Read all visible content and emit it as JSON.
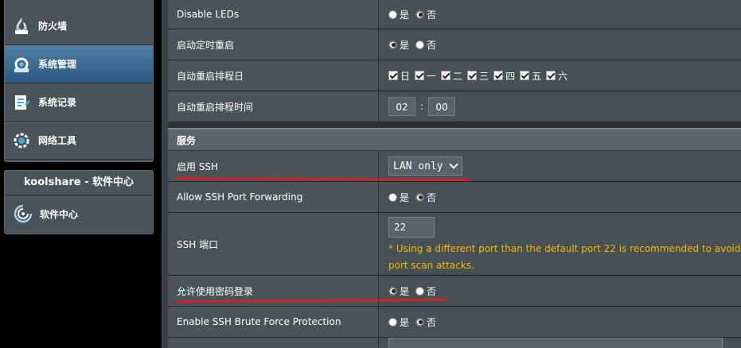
{
  "sidebar": {
    "items": [
      {
        "label": "防火墙",
        "icon": "firewall-icon"
      },
      {
        "label": "系统管理",
        "icon": "system-admin-icon",
        "active": true
      },
      {
        "label": "系统记录",
        "icon": "system-log-icon"
      },
      {
        "label": "网络工具",
        "icon": "network-tools-icon"
      }
    ],
    "koolshare": {
      "title": "koolshare - 软件中心",
      "item_label": "软件中心",
      "item_icon": "software-center-icon"
    }
  },
  "settings": {
    "disable_leds": {
      "label": "Disable LEDs",
      "opt_yes": "是",
      "opt_no": "否",
      "selected": "否"
    },
    "scheduled_reboot": {
      "label": "启动定时重启",
      "opt_yes": "是",
      "opt_no": "否",
      "selected": "是"
    },
    "reboot_days": {
      "label": "自动重启排程日",
      "days": [
        "日",
        "一",
        "二",
        "三",
        "四",
        "五",
        "六"
      ]
    },
    "reboot_time": {
      "label": "自动重启排程时间",
      "hour": "02",
      "minute": "00",
      "separator": ":"
    },
    "service_header": "服务",
    "enable_ssh": {
      "label": "启用 SSH",
      "value": "LAN only"
    },
    "ssh_port_forwarding": {
      "label": "Allow SSH Port Forwarding",
      "opt_yes": "是",
      "opt_no": "否",
      "selected": "否"
    },
    "ssh_port": {
      "label": "SSH 端口",
      "value": "22",
      "hint": "* Using a different port than the default port 22 is recommended to avoid port scan attacks."
    },
    "password_login": {
      "label": "允许使用密码登录",
      "opt_yes": "是",
      "opt_no": "否",
      "selected": "是"
    },
    "brute_force": {
      "label": "Enable SSH Brute Force Protection",
      "opt_yes": "是",
      "opt_no": "否",
      "selected": "否"
    }
  },
  "colors": {
    "annotation_red": "#d4202a",
    "hint_yellow": "#f5b800",
    "active_blue": "#3a6a92"
  }
}
